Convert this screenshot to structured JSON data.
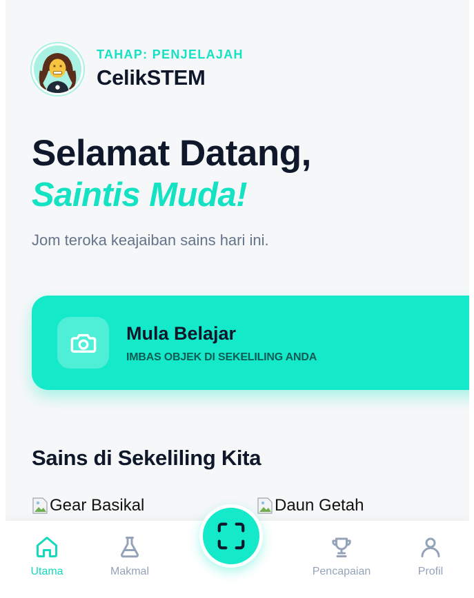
{
  "profile": {
    "stage_label": "TAHAP: PENJELAJAH",
    "brand_name": "CelikSTEM"
  },
  "hero": {
    "greeting": "Selamat Datang,",
    "highlight": "Saintis Muda!",
    "subtitle": "Jom teroka keajaiban sains hari ini."
  },
  "cta": {
    "icon": "camera-icon",
    "title": "Mula Belajar",
    "subtitle": "IMBAS OBJEK DI SEKELILING ANDA"
  },
  "section": {
    "title": "Sains di Sekeliling Kita",
    "items": [
      {
        "alt": "Gear Basikal"
      },
      {
        "alt": "Daun Getah"
      }
    ]
  },
  "bottom_nav": {
    "items": [
      {
        "label": "Utama",
        "icon": "home-icon",
        "active": true
      },
      {
        "label": "Makmal",
        "icon": "flask-icon",
        "active": false
      },
      {
        "label": "Pencapaian",
        "icon": "trophy-icon",
        "active": false
      },
      {
        "label": "Profil",
        "icon": "user-icon",
        "active": false
      }
    ],
    "scan_icon": "scan-icon"
  },
  "colors": {
    "accent": "#14e9c9",
    "accent_text": "#14e2c2",
    "heading": "#0f172a",
    "muted": "#64748b",
    "nav_inactive": "#94a3b8"
  }
}
